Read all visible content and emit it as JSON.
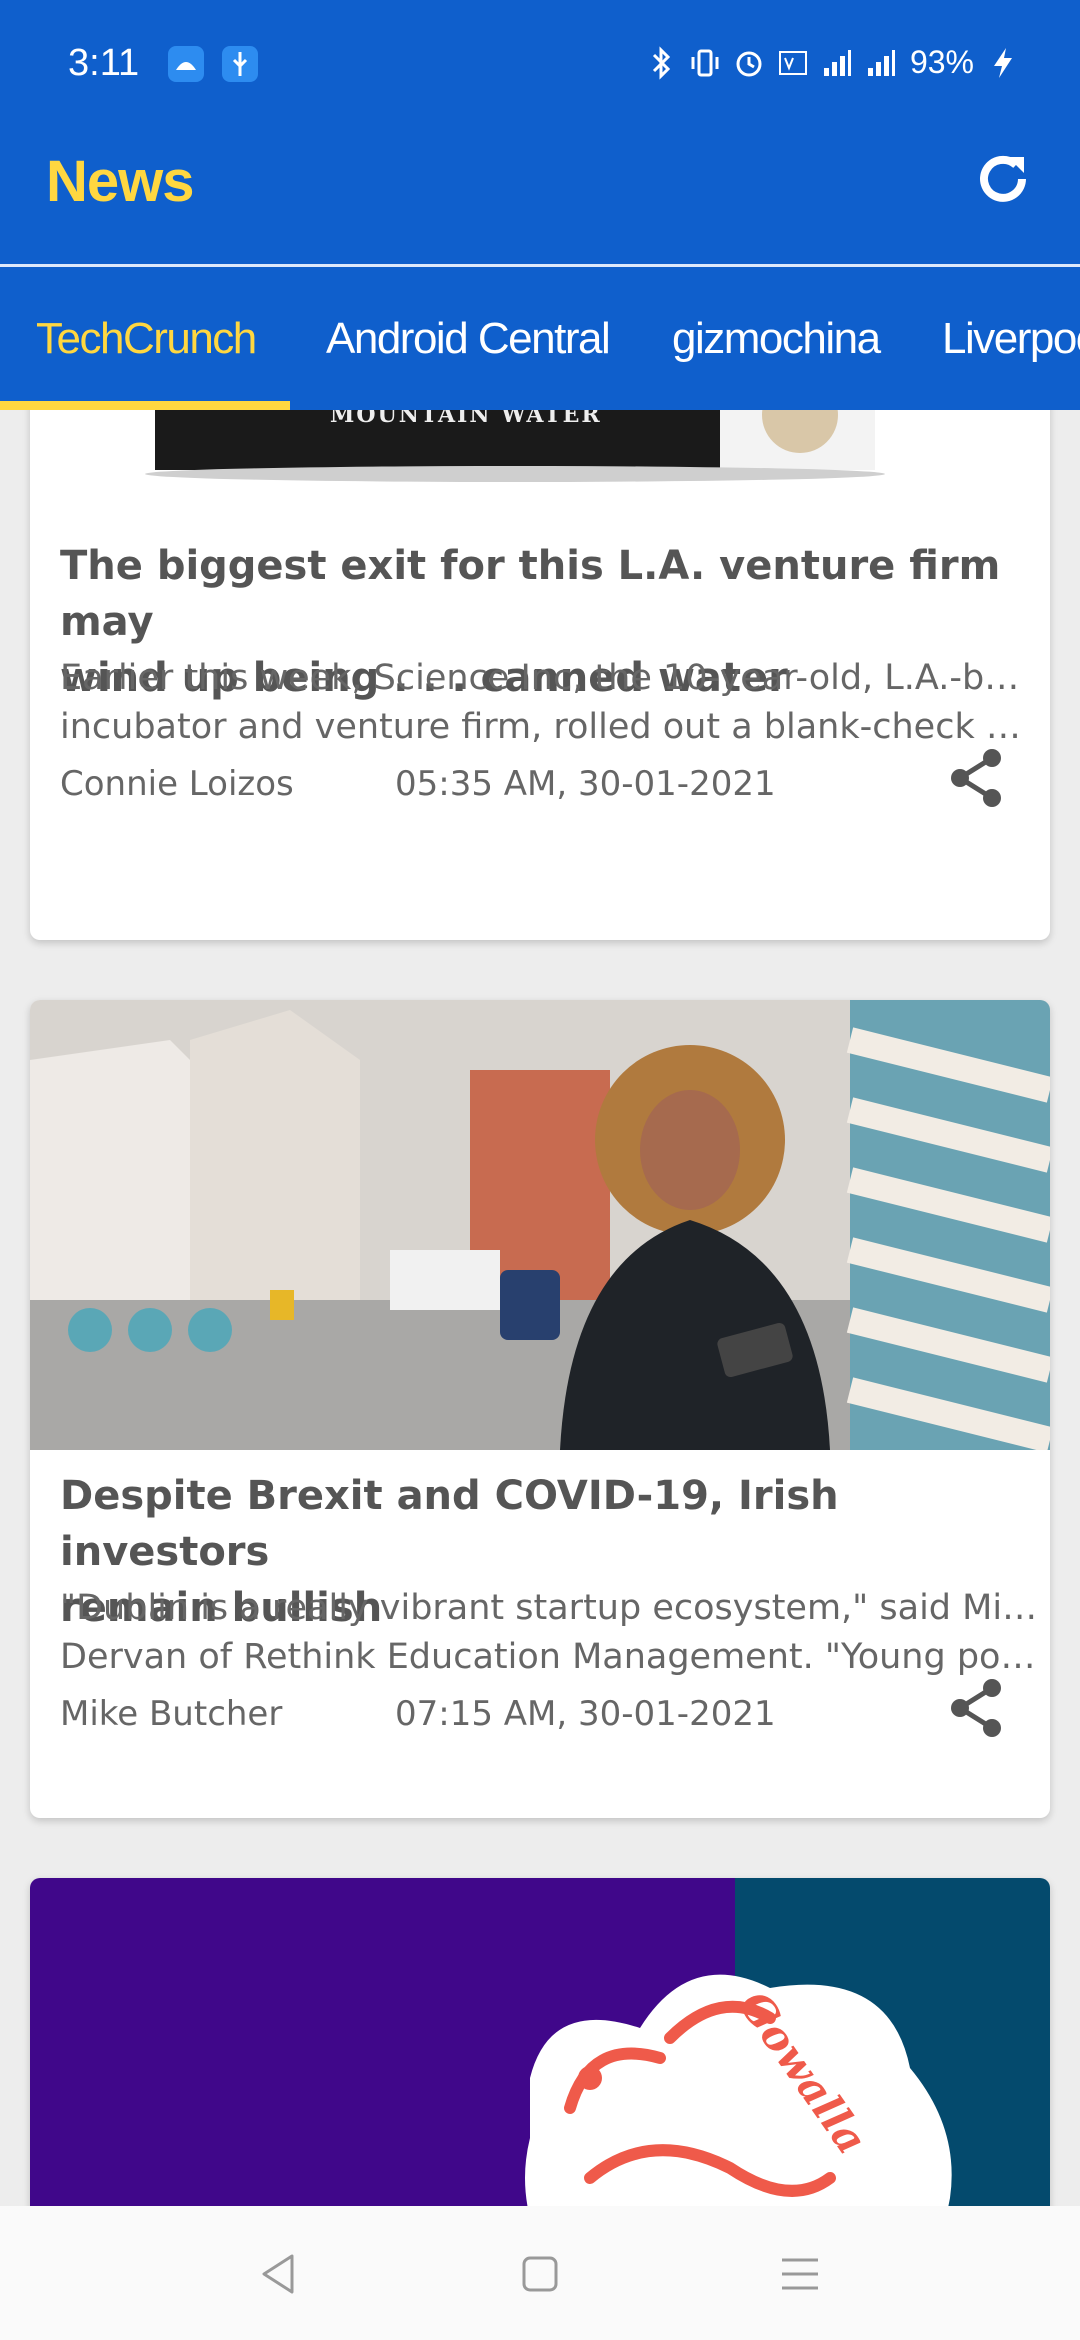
{
  "status": {
    "time": "3:11",
    "battery": "93%"
  },
  "app": {
    "title": "News"
  },
  "tabs": [
    {
      "label": "TechCrunch"
    },
    {
      "label": "Android Central"
    },
    {
      "label": "gizmochina"
    },
    {
      "label": "Liverpool"
    }
  ],
  "articles": [
    {
      "image_caption": "MOUNTAIN WATER",
      "title_lines": [
        "The biggest exit for this L.A. venture firm may",
        "wind up being . . . canned water"
      ],
      "desc_lines": [
        "Earlier this week, Science Inc, the 10-year-old, L.A.-based",
        "incubator and venture firm, rolled out a blank-check co…"
      ],
      "author": "Connie Loizos",
      "date": "05:35 AM, 30-01-2021"
    },
    {
      "title_lines": [
        "Despite Brexit and COVID-19, Irish investors",
        "remain bullish"
      ],
      "desc_lines": [
        "\"Dublin is a really vibrant startup ecosystem,\" said Michelle",
        "Dervan of Rethink Education Management. \"Young popu…"
      ],
      "author": "Mike Butcher",
      "date": "07:15 AM, 30-01-2021"
    },
    {
      "logo_text": "Gowalla"
    }
  ]
}
